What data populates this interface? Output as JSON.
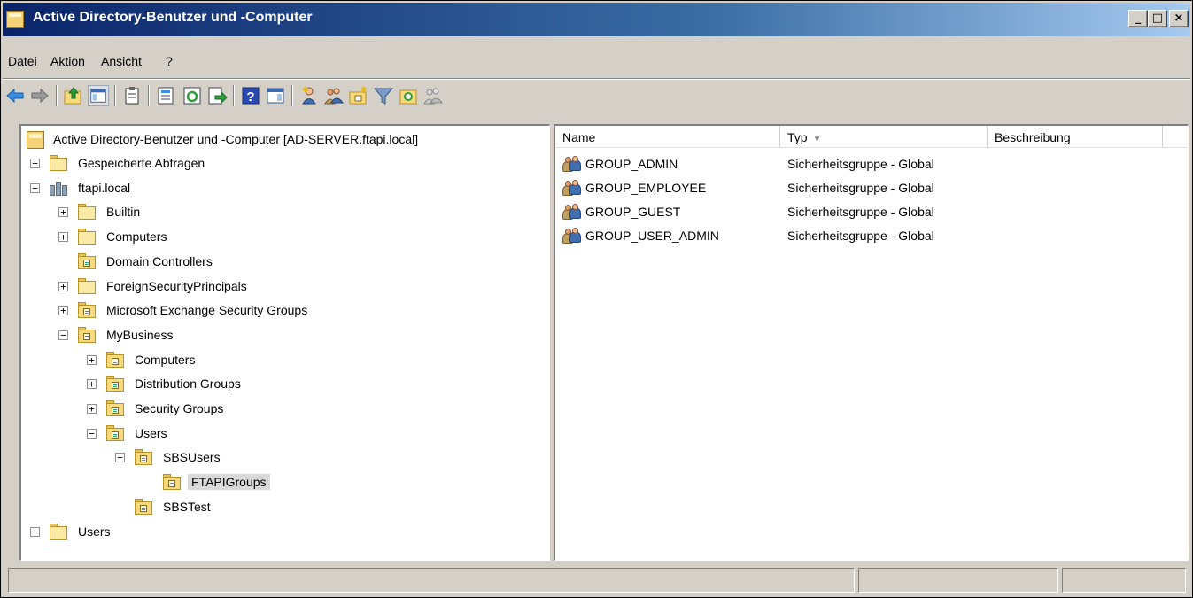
{
  "window": {
    "title": "Active Directory-Benutzer und -Computer",
    "controls": {
      "minimize": "_",
      "maximize": "□",
      "close": "×"
    }
  },
  "menu": [
    "Datei",
    "Aktion",
    "Ansicht",
    "?"
  ],
  "toolbar": {
    "buttons": [
      "back-icon",
      "forward-icon",
      "up-folder-icon",
      "console-tree-icon",
      "clipboard-icon",
      "properties-icon",
      "refresh-icon",
      "export-list-icon",
      "help-icon",
      "show-hide-action-pane-icon",
      "new-user-icon",
      "new-group-icon",
      "new-ou-icon",
      "filter-icon",
      "find-icon",
      "add-to-group-icon"
    ]
  },
  "tree": {
    "root": "Active Directory-Benutzer und -Computer [AD-SERVER.ftapi.local]",
    "nodes": [
      {
        "label": "Gespeicherte Abfragen",
        "expander": "+",
        "icon": "folder"
      },
      {
        "label": "ftapi.local",
        "expander": "−",
        "icon": "domain"
      },
      {
        "label": "Builtin",
        "expander": "+",
        "icon": "folder"
      },
      {
        "label": "Computers",
        "expander": "+",
        "icon": "folder"
      },
      {
        "label": "Domain Controllers",
        "expander": "",
        "icon": "ou"
      },
      {
        "label": "ForeignSecurityPrincipals",
        "expander": "+",
        "icon": "folder"
      },
      {
        "label": "Microsoft Exchange Security Groups",
        "expander": "+",
        "icon": "ou"
      },
      {
        "label": "MyBusiness",
        "expander": "−",
        "icon": "ou"
      },
      {
        "label": "Computers",
        "expander": "+",
        "icon": "ou"
      },
      {
        "label": "Distribution Groups",
        "expander": "+",
        "icon": "ou"
      },
      {
        "label": "Security Groups",
        "expander": "+",
        "icon": "ou"
      },
      {
        "label": "Users",
        "expander": "−",
        "icon": "ou"
      },
      {
        "label": "SBSUsers",
        "expander": "−",
        "icon": "ou"
      },
      {
        "label": "FTAPIGroups",
        "expander": "",
        "icon": "ou",
        "selected": true
      },
      {
        "label": "SBSTest",
        "expander": "",
        "icon": "ou"
      },
      {
        "label": "Users",
        "expander": "+",
        "icon": "folder"
      }
    ]
  },
  "list": {
    "columns": [
      "Name",
      "Typ",
      "Beschreibung"
    ],
    "sort_indicator": "▼",
    "rows": [
      {
        "name": "GROUP_ADMIN",
        "type": "Sicherheitsgruppe - Global",
        "description": ""
      },
      {
        "name": "GROUP_EMPLOYEE",
        "type": "Sicherheitsgruppe - Global",
        "description": ""
      },
      {
        "name": "GROUP_GUEST",
        "type": "Sicherheitsgruppe - Global",
        "description": ""
      },
      {
        "name": "GROUP_USER_ADMIN",
        "type": "Sicherheitsgruppe - Global",
        "description": ""
      }
    ]
  },
  "status": {
    "cells": [
      "",
      "",
      ""
    ]
  }
}
